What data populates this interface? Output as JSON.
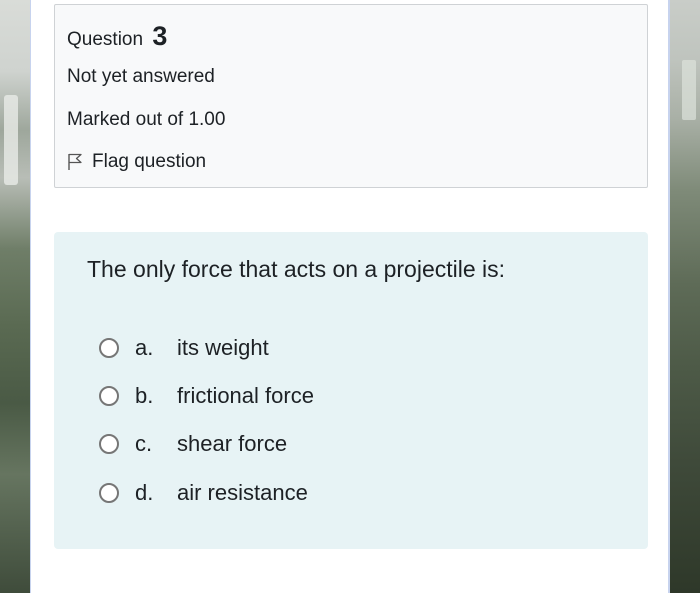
{
  "info": {
    "question_label": "Question",
    "question_number": "3",
    "state": "Not yet answered",
    "grade": "Marked out of 1.00",
    "flag_label": "Flag question"
  },
  "question": {
    "text": "The only force that acts on a projectile is:",
    "answers": [
      {
        "letter": "a.",
        "label": "its weight",
        "selected": false
      },
      {
        "letter": "b.",
        "label": "frictional force",
        "selected": false
      },
      {
        "letter": "c.",
        "label": "shear force",
        "selected": false
      },
      {
        "letter": "d.",
        "label": "air resistance",
        "selected": false
      }
    ]
  },
  "colors": {
    "info_bg": "#f8f9fa",
    "question_bg": "#e7f3f5",
    "text": "#1d2125",
    "border": "#cfd2d5"
  },
  "icons": {
    "flag": "flag-icon",
    "radio": "radio-button"
  }
}
